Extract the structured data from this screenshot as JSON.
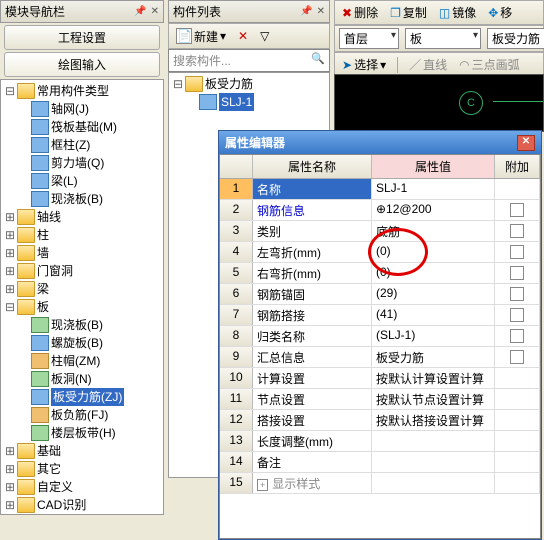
{
  "nav": {
    "title": "模块导航栏",
    "tab1": "工程设置",
    "tab2": "绘图输入"
  },
  "tree": {
    "root": "常用构件类型",
    "items": [
      "轴网(J)",
      "筏板基础(M)",
      "框柱(Z)",
      "剪力墙(Q)",
      "梁(L)",
      "现浇板(B)"
    ],
    "cats": [
      "轴线",
      "柱",
      "墙",
      "门窗洞",
      "梁"
    ],
    "ban": "板",
    "banItems": [
      "现浇板(B)",
      "螺旋板(B)",
      "柱帽(ZM)",
      "板洞(N)",
      "板受力筋(ZJ)",
      "板负筋(FJ)",
      "楼层板带(H)"
    ],
    "rest": [
      "基础",
      "其它",
      "自定义",
      "CAD识别"
    ]
  },
  "list": {
    "title": "构件列表",
    "new": "新建",
    "search": "搜索构件...",
    "root": "板受力筋",
    "item": "SLJ-1"
  },
  "tb": {
    "del": "删除",
    "copy": "复制",
    "mirror": "镜像",
    "move": "移",
    "floor": "首层",
    "ban": "板",
    "rebar": "板受力筋",
    "sel": "选择",
    "line": "直线",
    "arc": "三点画弧"
  },
  "canvas": {
    "c": "C"
  },
  "prop": {
    "title": "属性编辑器",
    "colName": "属性名称",
    "colVal": "属性值",
    "colAdd": "附加",
    "rows": [
      {
        "n": "1",
        "name": "名称",
        "val": "SLJ-1"
      },
      {
        "n": "2",
        "name": "钢筋信息",
        "val": "⊕12@200",
        "blue": true
      },
      {
        "n": "3",
        "name": "类别",
        "val": "底筋"
      },
      {
        "n": "4",
        "name": "左弯折(mm)",
        "val": "(0)"
      },
      {
        "n": "5",
        "name": "右弯折(mm)",
        "val": "(0)"
      },
      {
        "n": "6",
        "name": "钢筋锚固",
        "val": "(29)"
      },
      {
        "n": "7",
        "name": "钢筋搭接",
        "val": "(41)"
      },
      {
        "n": "8",
        "name": "归类名称",
        "val": "(SLJ-1)"
      },
      {
        "n": "9",
        "name": "汇总信息",
        "val": "板受力筋"
      },
      {
        "n": "10",
        "name": "计算设置",
        "val": "按默认计算设置计算"
      },
      {
        "n": "11",
        "name": "节点设置",
        "val": "按默认节点设置计算"
      },
      {
        "n": "12",
        "name": "搭接设置",
        "val": "按默认搭接设置计算"
      },
      {
        "n": "13",
        "name": "长度调整(mm)",
        "val": ""
      },
      {
        "n": "14",
        "name": "备注",
        "val": ""
      },
      {
        "n": "15",
        "name": "显示样式",
        "val": "",
        "gray": true,
        "exp": true
      }
    ]
  }
}
